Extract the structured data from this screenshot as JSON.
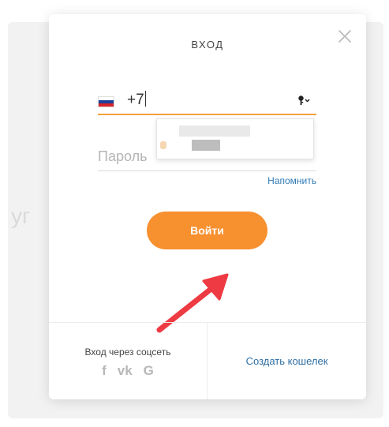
{
  "modal": {
    "title": "ВХОД",
    "phone": {
      "country_flag": "ru-flag",
      "value": "+7"
    },
    "password": {
      "placeholder": "Пароль"
    },
    "remind_label": "Напомнить",
    "login_label": "Войти",
    "social": {
      "label": "Вход через соцсеть",
      "icons": {
        "facebook": "f",
        "vk": "vk",
        "google": "G"
      }
    },
    "create_wallet_label": "Создать кошелек",
    "backdrop_ghost_text": "уг"
  },
  "colors": {
    "accent": "#f7902f",
    "input_underline": "#f3a13a",
    "link": "#2f7ab5",
    "arrow": "#ee3a42"
  }
}
